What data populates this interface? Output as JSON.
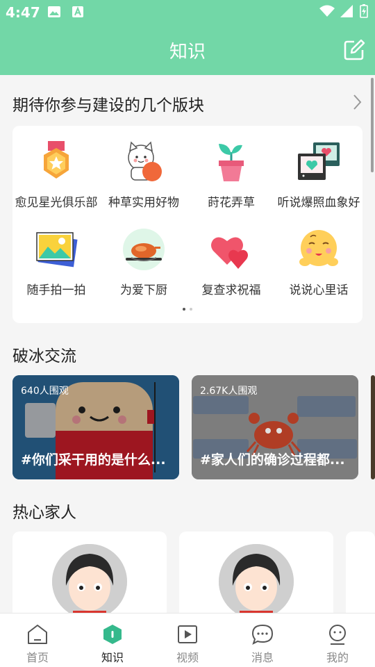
{
  "status_bar": {
    "time": "4:47"
  },
  "header": {
    "title": "知识"
  },
  "board_section": {
    "title": "期待你参与建设的几个版块",
    "items": [
      {
        "label": "愈见星光俱乐部",
        "icon": "medal-icon"
      },
      {
        "label": "种草实用好物",
        "icon": "lucky-cat-icon"
      },
      {
        "label": "莳花弄草",
        "icon": "potted-plant-icon"
      },
      {
        "label": "听说爆照血象好",
        "icon": "photo-frames-icon"
      },
      {
        "label": "随手拍一拍",
        "icon": "landscape-photo-icon"
      },
      {
        "label": "为爱下厨",
        "icon": "roast-chicken-icon"
      },
      {
        "label": "复查求祝福",
        "icon": "hearts-icon"
      },
      {
        "label": "说说心里话",
        "icon": "blushing-face-icon"
      }
    ]
  },
  "icebreak_section": {
    "title": "破冰交流",
    "topics": [
      {
        "views": "640人围观",
        "title": "#你们采干用的是什么..."
      },
      {
        "views": "2.67K人围观",
        "title": "#家人们的确诊过程都..."
      }
    ]
  },
  "family_section": {
    "title": "热心家人"
  },
  "tab_bar": {
    "tabs": [
      {
        "label": "首页",
        "icon": "home-icon"
      },
      {
        "label": "知识",
        "icon": "knowledge-icon"
      },
      {
        "label": "视频",
        "icon": "video-icon"
      },
      {
        "label": "消息",
        "icon": "message-icon"
      },
      {
        "label": "我的",
        "icon": "profile-icon"
      }
    ],
    "active": "知识"
  },
  "colors": {
    "brand_green": "#72d7a7",
    "active_icon": "#35b98c"
  }
}
